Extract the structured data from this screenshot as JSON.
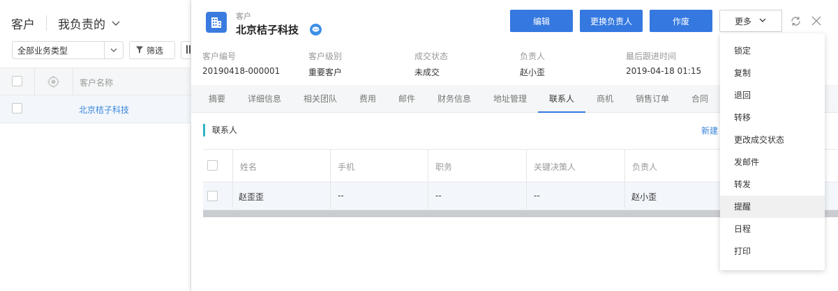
{
  "list": {
    "title": "客户",
    "view_label": "我负责的",
    "business_type": "全部业务类型",
    "filter_label": "筛选",
    "column_header": "客户名称",
    "rows": [
      {
        "name": "北京桔子科技"
      }
    ]
  },
  "detail": {
    "type_label": "客户",
    "name": "北京桔子科技",
    "buttons": {
      "edit": "编辑",
      "change_owner": "更换负责人",
      "void": "作废",
      "more": "更多"
    },
    "fields": [
      {
        "label": "客户编号",
        "value": "20190418-000001"
      },
      {
        "label": "客户级别",
        "value": "重要客户"
      },
      {
        "label": "成交状态",
        "value": "未成交"
      },
      {
        "label": "负责人",
        "value": "赵小歪"
      },
      {
        "label": "最后跟进时间",
        "value": "2019-04-18 01:15"
      }
    ],
    "tabs": [
      {
        "label": "摘要"
      },
      {
        "label": "详细信息"
      },
      {
        "label": "相关团队"
      },
      {
        "label": "费用"
      },
      {
        "label": "邮件"
      },
      {
        "label": "财务信息"
      },
      {
        "label": "地址管理"
      },
      {
        "label": "联系人",
        "active": true
      },
      {
        "label": "商机"
      },
      {
        "label": "销售订单"
      },
      {
        "label": "合同"
      }
    ],
    "contacts": {
      "title": "联系人",
      "new_label": "新建",
      "columns": [
        "姓名",
        "手机",
        "职务",
        "关键决策人",
        "负责人"
      ],
      "rows": [
        [
          "赵歪歪",
          "--",
          "--",
          "--",
          "赵小歪"
        ]
      ]
    }
  },
  "more_menu": {
    "items": [
      "锁定",
      "复制",
      "退回",
      "转移",
      "更改成交状态",
      "发邮件",
      "转发",
      "提醒",
      "日程",
      "打印"
    ],
    "highlighted_item": "提醒"
  },
  "icons": {
    "view_chevron": "chevron-down-icon",
    "filter": "filter-icon",
    "locate": "target-icon",
    "building": "building-icon",
    "chat": "chat-bubble-icon",
    "refresh": "refresh-icon",
    "close": "close-icon"
  },
  "colors": {
    "primary": "#3478e0",
    "link": "#3a86d9",
    "section_accent": "#2fb4c4",
    "row_highlight": "#f3f7fc"
  }
}
